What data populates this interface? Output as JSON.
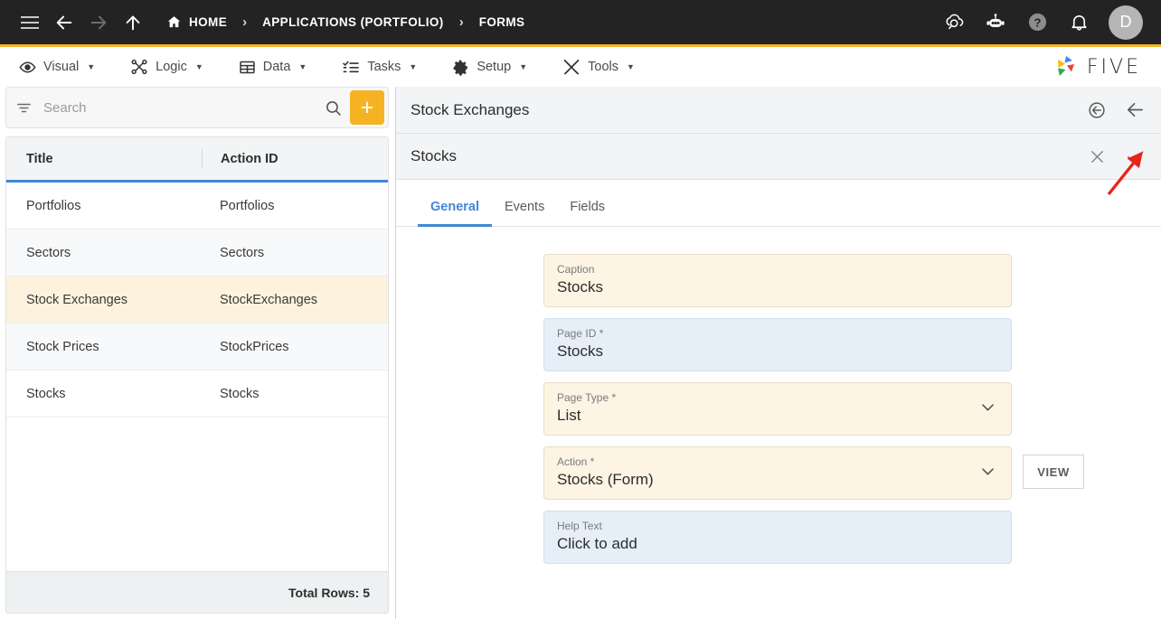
{
  "topbar": {
    "menu_icon": "hamburger-icon",
    "back_icon": "arrow-left-icon",
    "forward_icon": "arrow-right-icon",
    "up_icon": "arrow-up-icon",
    "home_label": "HOME",
    "breadcrumb": [
      "HOME",
      "APPLICATIONS (PORTFOLIO)",
      "FORMS"
    ],
    "separator": "›",
    "right_icons": [
      "cloud-search-icon",
      "chatbot-icon",
      "help-icon",
      "notifications-icon"
    ],
    "avatar_initial": "D",
    "bg_color": "#232323",
    "accent_color": "#f5b324"
  },
  "menubar": {
    "items": [
      {
        "label": "Visual",
        "icon": "eye-icon"
      },
      {
        "label": "Logic",
        "icon": "nodes-icon"
      },
      {
        "label": "Data",
        "icon": "table-icon"
      },
      {
        "label": "Tasks",
        "icon": "checklist-icon"
      },
      {
        "label": "Setup",
        "icon": "gear-icon"
      },
      {
        "label": "Tools",
        "icon": "tools-icon"
      }
    ],
    "caret": "▼",
    "brand": "FIVE"
  },
  "sidebar": {
    "search": {
      "placeholder": "Search",
      "filter_icon": "filter-icon",
      "search_icon": "search-icon"
    },
    "add_button_label": "+",
    "columns": [
      "Title",
      "Action ID"
    ],
    "rows": [
      {
        "title": "Portfolios",
        "action_id": "Portfolios"
      },
      {
        "title": "Sectors",
        "action_id": "Sectors"
      },
      {
        "title": "Stock Exchanges",
        "action_id": "StockExchanges"
      },
      {
        "title": "Stock Prices",
        "action_id": "StockPrices"
      },
      {
        "title": "Stocks",
        "action_id": "Stocks"
      }
    ],
    "selected_index": 2,
    "footer": "Total Rows: 5",
    "selected_row_color": "#fdf2dd",
    "header_underline_color": "#4187d6"
  },
  "panel": {
    "title": "Stock Exchanges",
    "revert_icon": "circle-back-arrow-icon",
    "close_panel_icon": "arrow-left-icon",
    "record": {
      "title": "Stocks",
      "cancel_icon": "close-x-icon",
      "save_icon": "checkmark-icon"
    },
    "tabs": [
      {
        "label": "General",
        "active": true
      },
      {
        "label": "Events",
        "active": false
      },
      {
        "label": "Fields",
        "active": false
      }
    ],
    "active_tab_color": "#4187d6",
    "fields": [
      {
        "label": "Caption",
        "value": "Stocks",
        "style": "cream",
        "type": "text"
      },
      {
        "label": "Page ID *",
        "value": "Stocks",
        "style": "blue",
        "type": "text"
      },
      {
        "label": "Page Type *",
        "value": "List",
        "style": "cream",
        "type": "select"
      },
      {
        "label": "Action *",
        "value": "Stocks (Form)",
        "style": "cream",
        "type": "select",
        "button": "VIEW"
      },
      {
        "label": "Help Text",
        "value": "Click to add",
        "style": "blue",
        "type": "text"
      }
    ]
  },
  "annotation": {
    "type": "arrow",
    "color": "#e8231a",
    "points_to": "save-checkmark-icon"
  }
}
